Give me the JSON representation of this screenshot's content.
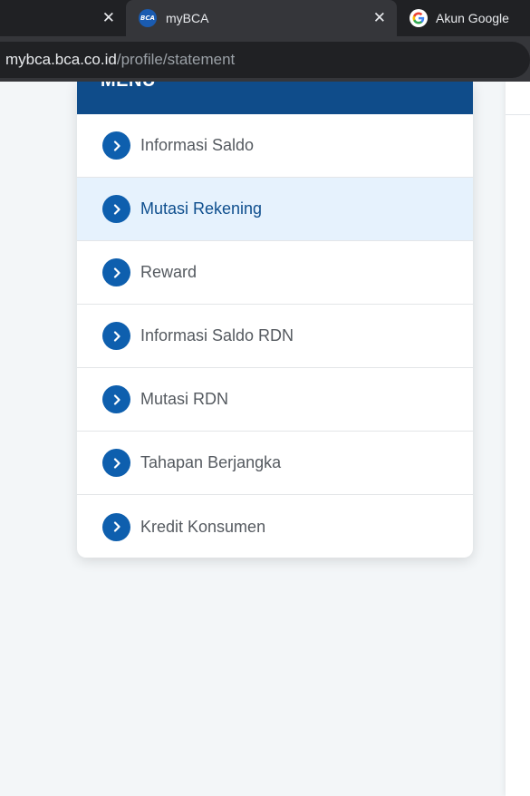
{
  "browser": {
    "tabs": [
      {
        "title": "",
        "close": "✕"
      },
      {
        "title": "myBCA",
        "favicon_text": "BCA",
        "close": "✕"
      },
      {
        "title": "Akun Google"
      }
    ],
    "url": {
      "host": "mybca.bca.co.id",
      "path": "/profile/statement"
    }
  },
  "menu": {
    "header": "MENU",
    "items": [
      {
        "label": "Informasi Saldo"
      },
      {
        "label": "Mutasi Rekening",
        "active": true
      },
      {
        "label": "Reward"
      },
      {
        "label": "Informasi Saldo RDN"
      },
      {
        "label": "Mutasi RDN"
      },
      {
        "label": "Tahapan Berjangka"
      },
      {
        "label": "Kredit Konsumen"
      }
    ]
  },
  "colors": {
    "header_bg": "#0f4c8a",
    "chevron_bg": "#0e5fae",
    "active_bg": "#e6f2fd",
    "active_text": "#0f4f8e"
  }
}
